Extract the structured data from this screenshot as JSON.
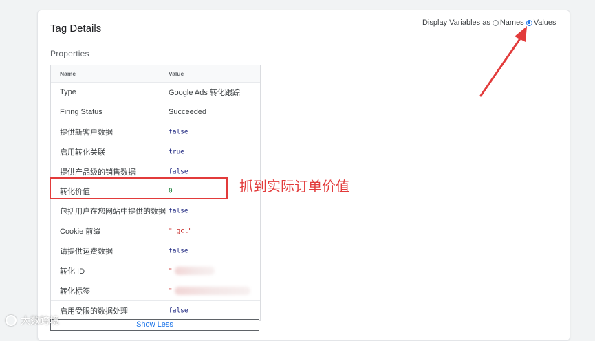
{
  "panel": {
    "title": "Tag Details",
    "section_label": "Properties"
  },
  "display_variables": {
    "label": "Display Variables as",
    "names_label": "Names",
    "values_label": "Values",
    "selected": "Values"
  },
  "table": {
    "headers": {
      "name": "Name",
      "value": "Value"
    },
    "rows": [
      {
        "name": "Type",
        "value": "Google Ads 转化跟踪"
      },
      {
        "name": "Firing Status",
        "value": "Succeeded"
      },
      {
        "name": "提供新客户数据",
        "value": "false"
      },
      {
        "name": "启用转化关联",
        "value": "true"
      },
      {
        "name": "提供产品级的销售数据",
        "value": "false"
      },
      {
        "name": "转化价值",
        "value": "0"
      },
      {
        "name": "包括用户在您网站中提供的数据",
        "value": "false"
      },
      {
        "name": "Cookie 前缀",
        "value": "\"_gcl\""
      },
      {
        "name": "请提供运费数据",
        "value": "false"
      },
      {
        "name": "转化 ID",
        "value": "\""
      },
      {
        "name": "转化标签",
        "value": "\""
      },
      {
        "name": "启用受限的数据处理",
        "value": "false"
      }
    ]
  },
  "show_less_label": "Show Less",
  "annotation": {
    "text": "抓到实际订单价值",
    "color": "#e23b3b",
    "highlighted_row": "转化价值"
  },
  "watermark": {
    "text": "大数跨境"
  },
  "colors": {
    "link_blue": "#1a73e8",
    "boolean_blue": "#1a237e",
    "number_green": "#188038",
    "string_red": "#c5221f",
    "annotation_red": "#e23b3b"
  }
}
